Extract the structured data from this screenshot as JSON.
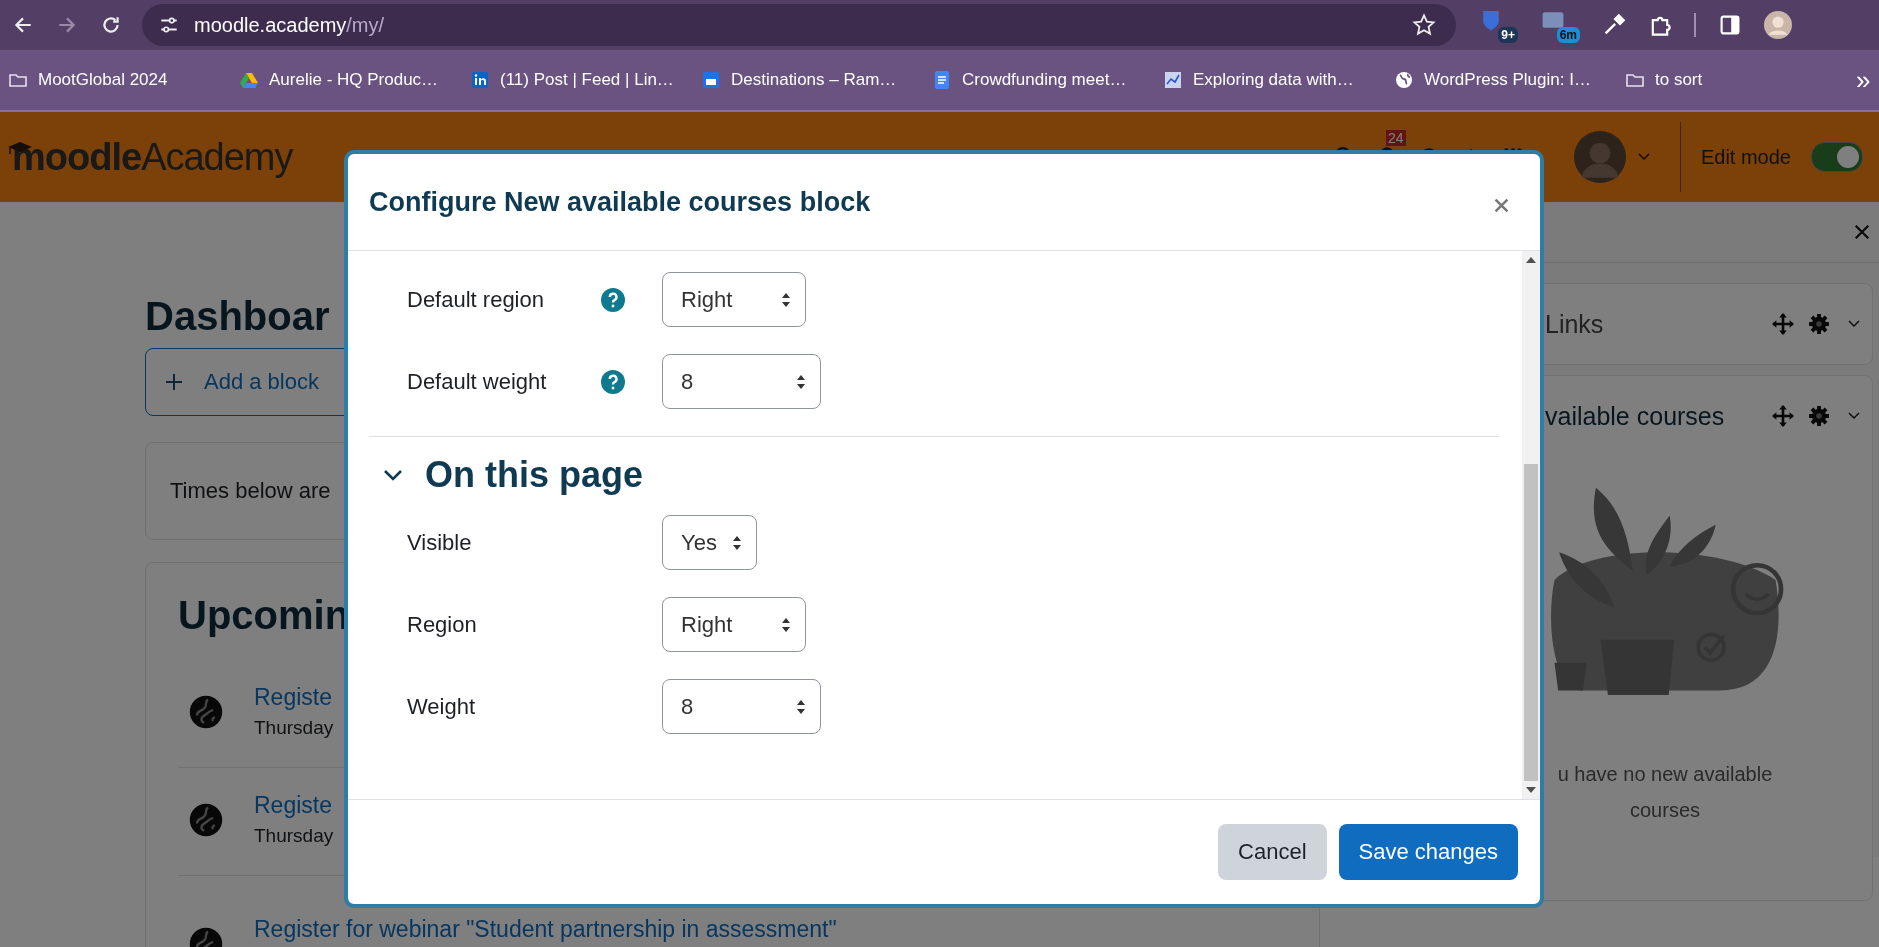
{
  "browser": {
    "url_host": "moodle.academy",
    "url_path": "/my/",
    "extension_badges": [
      "9+",
      "6m"
    ],
    "bookmarks": [
      {
        "kind": "folder",
        "label": "MootGlobal 2024"
      },
      {
        "kind": "drive",
        "label": "Aurelie - HQ Produc…"
      },
      {
        "kind": "linkedin",
        "label": "(11) Post | Feed | Lin…"
      },
      {
        "kind": "tile",
        "label": "Destinations – Ram…"
      },
      {
        "kind": "docs",
        "label": "Crowdfunding meet…"
      },
      {
        "kind": "chart",
        "label": "Exploring data with…"
      },
      {
        "kind": "globe",
        "label": "WordPress Plugin: I…"
      },
      {
        "kind": "folder",
        "label": "to sort"
      }
    ],
    "more": "»"
  },
  "site_header": {
    "logo": "**moodle**Academy",
    "notification_count": "24",
    "edit_mode": {
      "label": "Edit mode",
      "on": true
    }
  },
  "main": {
    "heading": "Dashboar",
    "add_block": "Add a block",
    "notice": "Times below are",
    "upcoming_title": "Upcomin",
    "events": [
      {
        "title": "Registe",
        "date": "Thursday"
      },
      {
        "title": "Registe",
        "date": "Thursday"
      },
      {
        "title": "Register for webinar \"Student partnership in assessment\""
      }
    ]
  },
  "drawer": {
    "blocks": [
      {
        "title": "Links"
      },
      {
        "title": "vailable courses",
        "empty_text": "u have no new available courses"
      }
    ]
  },
  "dialog": {
    "title": "Configure New available courses block",
    "sections": [
      {
        "fields": [
          {
            "kind": "region",
            "label": "Default region",
            "value": "Right",
            "help": true
          },
          {
            "kind": "weight",
            "label": "Default weight",
            "value": "8",
            "help": true
          }
        ]
      },
      {
        "heading": "On this page",
        "expanded": true,
        "fields": [
          {
            "kind": "visibility",
            "label": "Visible",
            "value": "Yes",
            "help": false
          },
          {
            "kind": "region",
            "label": "Region",
            "value": "Right",
            "help": false
          },
          {
            "kind": "weight",
            "label": "Weight",
            "value": "8",
            "help": false
          }
        ]
      }
    ],
    "buttons": [
      {
        "kind": "secondary",
        "label": "Cancel"
      },
      {
        "kind": "primary",
        "label": "Save changes"
      }
    ]
  }
}
